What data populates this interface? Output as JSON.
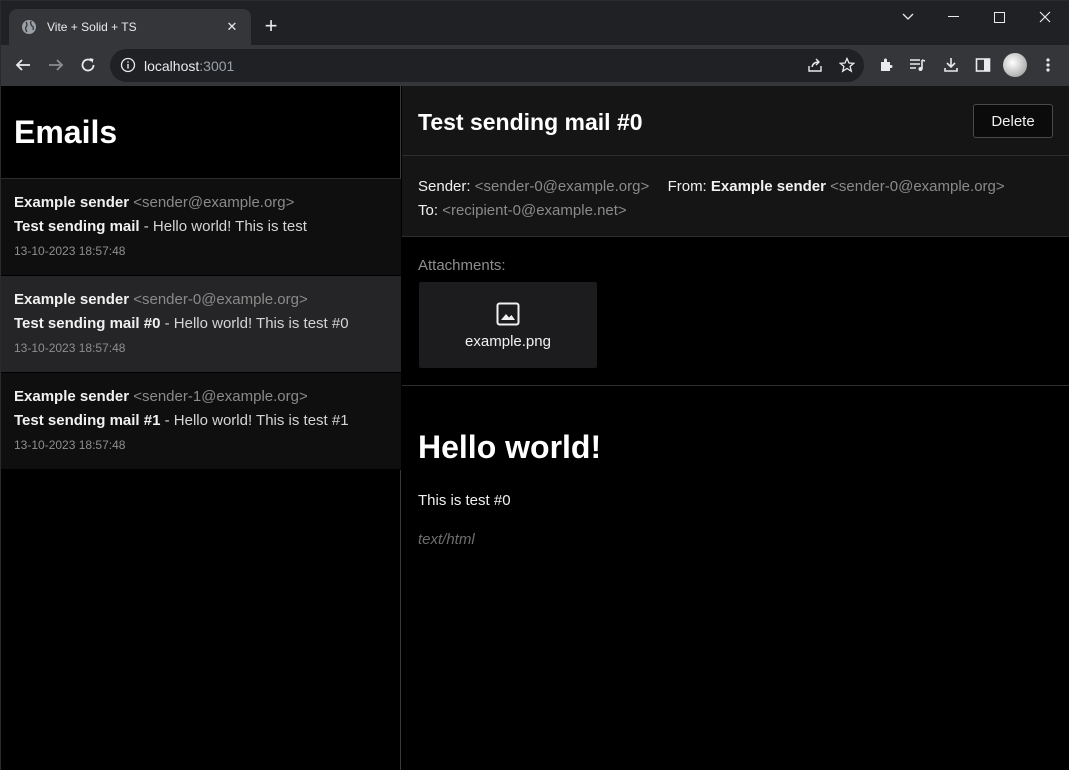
{
  "browser": {
    "tab_title": "Vite + Solid + TS",
    "url_host": "localhost",
    "url_port": ":3001"
  },
  "sidebar": {
    "title": "Emails",
    "items": [
      {
        "sender_name": "Example sender",
        "sender_addr": "<sender@example.org>",
        "subject": "Test sending mail",
        "preview": " - Hello world! This is test",
        "date": "13-10-2023 18:57:48",
        "active": false
      },
      {
        "sender_name": "Example sender",
        "sender_addr": "<sender-0@example.org>",
        "subject": "Test sending mail #0",
        "preview": " - Hello world! This is test #0",
        "date": "13-10-2023 18:57:48",
        "active": true
      },
      {
        "sender_name": "Example sender",
        "sender_addr": "<sender-1@example.org>",
        "subject": "Test sending mail #1",
        "preview": " - Hello world! This is test #1",
        "date": "13-10-2023 18:57:48",
        "active": false
      }
    ]
  },
  "detail": {
    "subject": "Test sending mail #0",
    "delete_label": "Delete",
    "sender_label": "Sender:",
    "sender_addr": "<sender-0@example.org>",
    "from_label": "From:",
    "from_name": "Example sender",
    "from_addr": "<sender-0@example.org>",
    "to_label": "To:",
    "to_addr": "<recipient-0@example.net>",
    "attachments_label": "Attachments:",
    "attachment_name": "example.png",
    "body_heading": "Hello world!",
    "body_text": "This is test #0",
    "content_type": "text/html"
  }
}
